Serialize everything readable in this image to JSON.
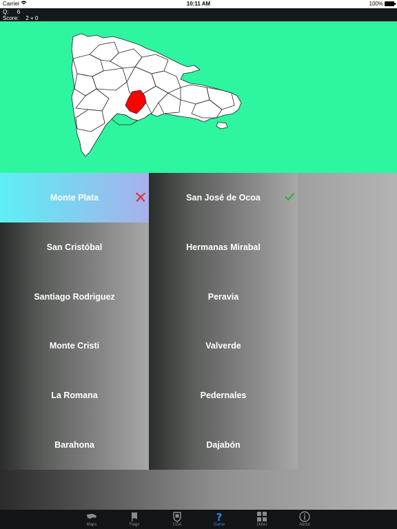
{
  "status_bar": {
    "carrier": "Carrier",
    "time": "10:11 AM",
    "battery": "100%"
  },
  "info": {
    "q_label": "Q:",
    "q_value": "6",
    "score_label": "Score:",
    "score_value": "2 + 0"
  },
  "colors": {
    "map_background": "#2ef59f",
    "highlight_province": "#ff0000",
    "correct_mark": "#2fb52f",
    "wrong_mark": "#e0302f",
    "active_tab": "#2a8bf2"
  },
  "answers_left": [
    {
      "label": "Monte Plata",
      "state": "wrong"
    },
    {
      "label": "San Cristóbal",
      "state": "none"
    },
    {
      "label": "Santiago Rodriguez",
      "state": "none"
    },
    {
      "label": "Monte Cristi",
      "state": "none"
    },
    {
      "label": "La Romana",
      "state": "none"
    },
    {
      "label": "Barahona",
      "state": "none"
    }
  ],
  "answers_right": [
    {
      "label": "San José de Ocoa",
      "state": "correct"
    },
    {
      "label": "Hermanas Mirabal",
      "state": "none"
    },
    {
      "label": "Peravia",
      "state": "none"
    },
    {
      "label": "Valverde",
      "state": "none"
    },
    {
      "label": "Pedernales",
      "state": "none"
    },
    {
      "label": "Dajabón",
      "state": "none"
    }
  ],
  "tabs": [
    {
      "label": "Maps",
      "icon": "map-icon",
      "active": false
    },
    {
      "label": "Flags",
      "icon": "flag-icon",
      "active": false
    },
    {
      "label": "COA",
      "icon": "coat-of-arms-icon",
      "active": false
    },
    {
      "label": "Game",
      "icon": "question-icon",
      "active": true
    },
    {
      "label": "Other",
      "icon": "grid-icon",
      "active": false
    },
    {
      "label": "About",
      "icon": "info-icon",
      "active": false
    }
  ]
}
